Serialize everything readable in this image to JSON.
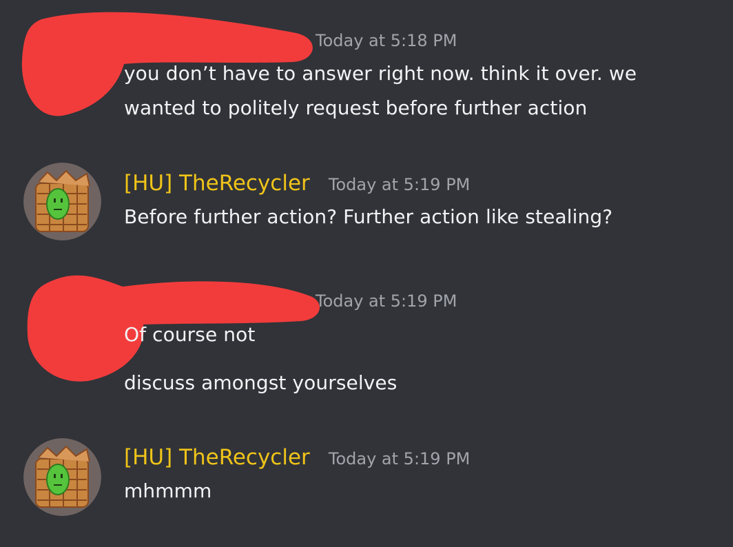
{
  "messages": [
    {
      "username": "",
      "timestamp": "Today at 5:18 PM",
      "lines": [
        "you don’t have to answer right now. think it over. we",
        "wanted to politely request before further action"
      ],
      "redacted": true
    },
    {
      "username": "[HU] TheRecycler",
      "timestamp": "Today at 5:19 PM",
      "lines": [
        "Before further action? Further action like stealing?"
      ],
      "redacted": false
    },
    {
      "username": "",
      "timestamp": "Today at 5:19 PM",
      "lines": [
        "Of course not",
        "discuss amongst yourselves"
      ],
      "redacted": true
    },
    {
      "username": "[HU] TheRecycler",
      "timestamp": "Today at 5:19 PM",
      "lines": [
        "mhmmm"
      ],
      "redacted": false
    }
  ],
  "colors": {
    "background": "#313338",
    "username": "#f0c419",
    "timestamp": "#a1a4ab",
    "message_text": "#f2f3f5",
    "redaction": "#f23c3c"
  },
  "icons": {
    "avatar": "recycler-avatar-icon"
  }
}
